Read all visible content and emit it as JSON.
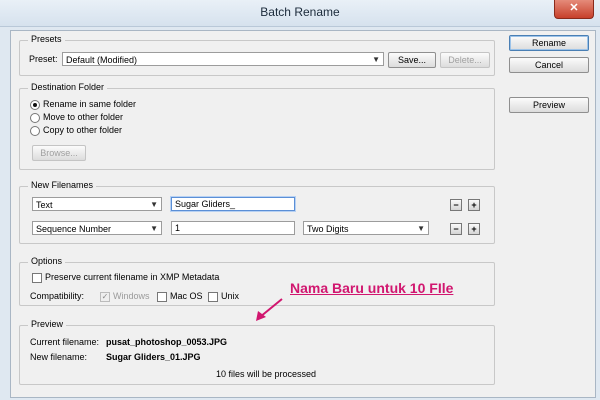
{
  "window": {
    "title": "Batch Rename",
    "close_label": "✕"
  },
  "buttons": {
    "rename": "Rename",
    "cancel": "Cancel",
    "preview": "Preview"
  },
  "presets": {
    "group_title": "Presets",
    "preset_label": "Preset:",
    "preset_value": "Default (Modified)",
    "save_label": "Save...",
    "delete_label": "Delete..."
  },
  "destination": {
    "group_title": "Destination Folder",
    "options": [
      "Rename in same folder",
      "Move to other folder",
      "Copy to other folder"
    ],
    "selected_index": 0,
    "browse_label": "Browse..."
  },
  "new_filenames": {
    "group_title": "New Filenames",
    "rows": [
      {
        "type": "Text",
        "value": "Sugar Gliders_",
        "extra": ""
      },
      {
        "type": "Sequence Number",
        "value": "1",
        "extra": "Two Digits"
      }
    ],
    "minus_label": "−",
    "plus_label": "+"
  },
  "options": {
    "group_title": "Options",
    "preserve_label": "Preserve current filename in XMP Metadata",
    "compatibility_label": "Compatibility:",
    "windows_label": "Windows",
    "macos_label": "Mac OS",
    "unix_label": "Unix"
  },
  "annotation": {
    "text": "Nama Baru untuk 10 FIle",
    "color": "#d1166f"
  },
  "preview": {
    "group_title": "Preview",
    "current_label": "Current filename:",
    "current_value": "pusat_photoshop_0053.JPG",
    "new_label": "New filename:",
    "new_value": "Sugar Gliders_01.JPG",
    "status": "10 files will be processed"
  }
}
